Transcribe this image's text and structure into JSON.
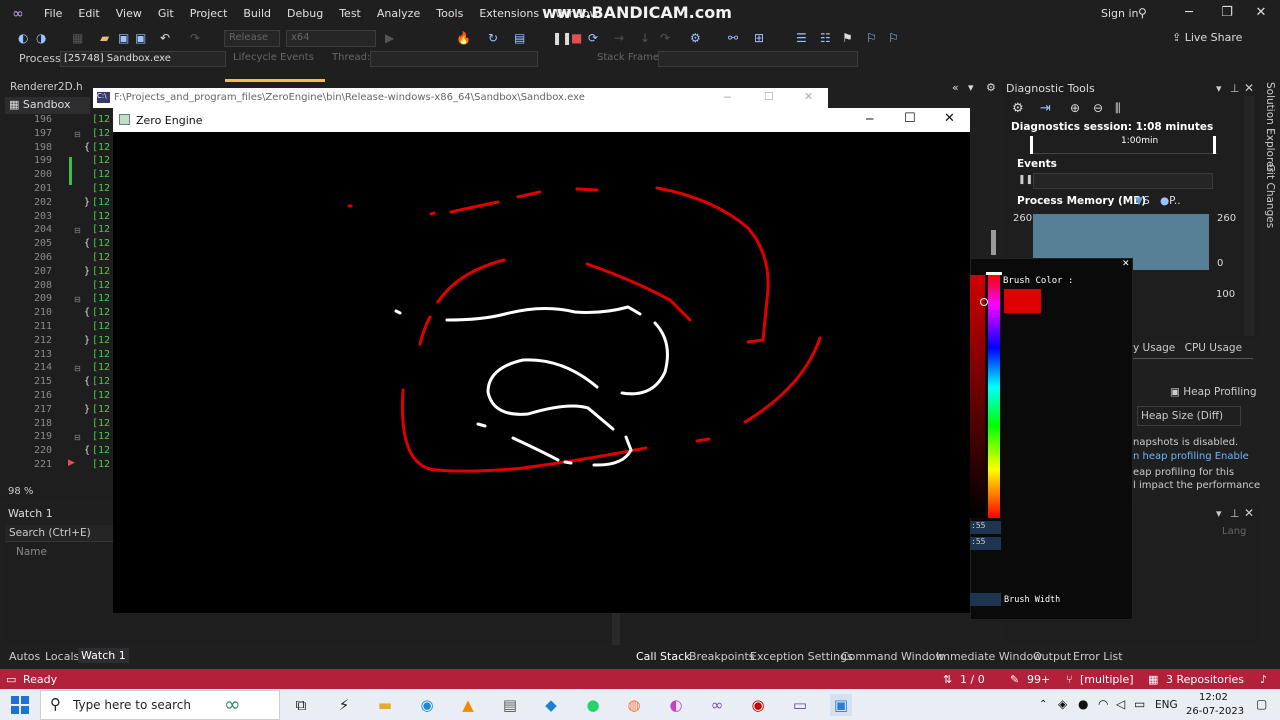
{
  "watermark": "www.BANDICAM.com",
  "menu": [
    "File",
    "Edit",
    "View",
    "Git",
    "Project",
    "Build",
    "Debug",
    "Test",
    "Analyze",
    "Tools",
    "Extensions",
    "Window"
  ],
  "signin": "Sign in",
  "liveshare": "Live Share",
  "toolbar": {
    "config": "Release",
    "platform": "x64",
    "continue": "Continue"
  },
  "process": {
    "label": "Process:",
    "value": "[25748] Sandbox.exe",
    "lifecycle": "Lifecycle Events",
    "thread": "Thread:",
    "stackframe": "Stack Frame:"
  },
  "doctabs": {
    "renderer": "Renderer2D.h",
    "sandbox": "Sandbox"
  },
  "editor": {
    "lines": [
      "196",
      "197",
      "198",
      "199",
      "200",
      "201",
      "202",
      "203",
      "204",
      "205",
      "206",
      "207",
      "208",
      "209",
      "210",
      "211",
      "212",
      "213",
      "214",
      "215",
      "216",
      "217",
      "218",
      "219",
      "220",
      "221"
    ],
    "code_prefix": "[12",
    "zoom": "98 %"
  },
  "watch": {
    "title": "Watch 1",
    "search": "Search (Ctrl+E)",
    "name_col": "Name"
  },
  "bottom_tabs_left": [
    "Autos",
    "Locals",
    "Watch 1"
  ],
  "bottom_tabs_right": [
    "Call Stack",
    "Breakpoints",
    "Exception Settings",
    "Command Window",
    "Immediate Window",
    "Output",
    "Error List"
  ],
  "diag": {
    "title": "Diagnostic Tools",
    "session": "Diagnostics session: 1:08 minutes",
    "timeline_label": "1:00min",
    "events": "Events",
    "process_memory": "Process Memory (MB)",
    "legend_s": "S",
    "legend_p": "P..",
    "mem_max_left": "260",
    "mem_max_right": "260",
    "mem_zero_right": "0",
    "cpu_max": "100",
    "tabs": [
      "y Usage",
      "CPU Usage"
    ],
    "heap_profiling": "Heap Profiling",
    "heap_diff": "Heap Size (Diff)",
    "heap_msgs": [
      "napshots is disabled.",
      "n heap profiling Enable",
      "eap profiling  for this",
      "l impact the performance"
    ],
    "lang_col": "Lang"
  },
  "vertical_tabs": [
    "Solution Explorer",
    "Git Changes"
  ],
  "console": {
    "path": "F:\\Projects_and_program_files\\ZeroEngine\\bin\\Release-windows-x86_64\\Sandbox\\Sandbox.exe"
  },
  "zero_engine": {
    "title": "Zero Engine"
  },
  "imgui": {
    "brush_color": "Brush Color :",
    "field1": ":55",
    "field2": ":55",
    "brush_width": "Brush Width",
    "brush_color_value": "#e00000"
  },
  "status": {
    "ready": "Ready",
    "lines": "1 / 0",
    "pencil": "99+",
    "branch": "[multiple]",
    "repos": "3 Repositories"
  },
  "taskbar": {
    "search": "Type here to search",
    "lang": "ENG",
    "time": "12:02",
    "date": "26-07-2023"
  },
  "colors": {
    "accent_status": "#b2203a",
    "brush_red": "#e00000",
    "stroke_white": "#ffffff"
  }
}
